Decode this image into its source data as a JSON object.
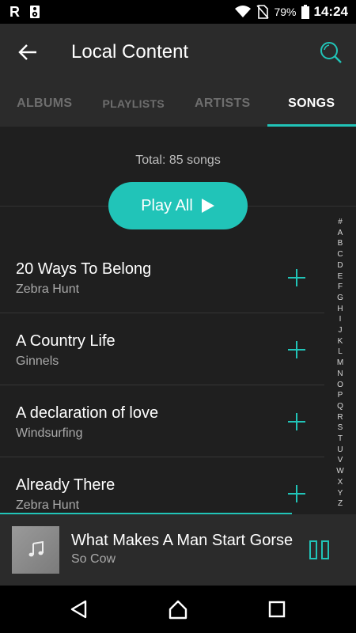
{
  "status_bar": {
    "app_letter": "R",
    "battery": "79%",
    "time": "14:24"
  },
  "app_bar": {
    "title": "Local Content",
    "back_icon": "arrow-left-icon",
    "search_icon": "search-icon"
  },
  "tabs": [
    {
      "label": "ALBUMS",
      "active": false
    },
    {
      "label": "PLAYLISTS",
      "active": false
    },
    {
      "label": "ARTISTS",
      "active": false
    },
    {
      "label": "SONGS",
      "active": true
    }
  ],
  "summary": {
    "total_text": "Total: 85 songs",
    "play_all_label": "Play All"
  },
  "songs": [
    {
      "title": "20 Ways To Belong",
      "artist": "Zebra Hunt"
    },
    {
      "title": "A Country Life",
      "artist": "Ginnels"
    },
    {
      "title": "A declaration of love",
      "artist": "Windsurfing"
    },
    {
      "title": "Already There",
      "artist": "Zebra Hunt"
    }
  ],
  "alphabet_index": [
    "#",
    "A",
    "B",
    "C",
    "D",
    "E",
    "F",
    "G",
    "H",
    "I",
    "J",
    "K",
    "L",
    "M",
    "N",
    "O",
    "P",
    "Q",
    "R",
    "S",
    "T",
    "U",
    "V",
    "W",
    "X",
    "Y",
    "Z"
  ],
  "now_playing": {
    "title": "What Makes A Man Start Gorse",
    "artist": "So Cow",
    "state": "playing",
    "progress": 0.82
  },
  "colors": {
    "accent": "#21c4b8",
    "background": "#1f1f1f",
    "bar": "#2b2b2b"
  }
}
